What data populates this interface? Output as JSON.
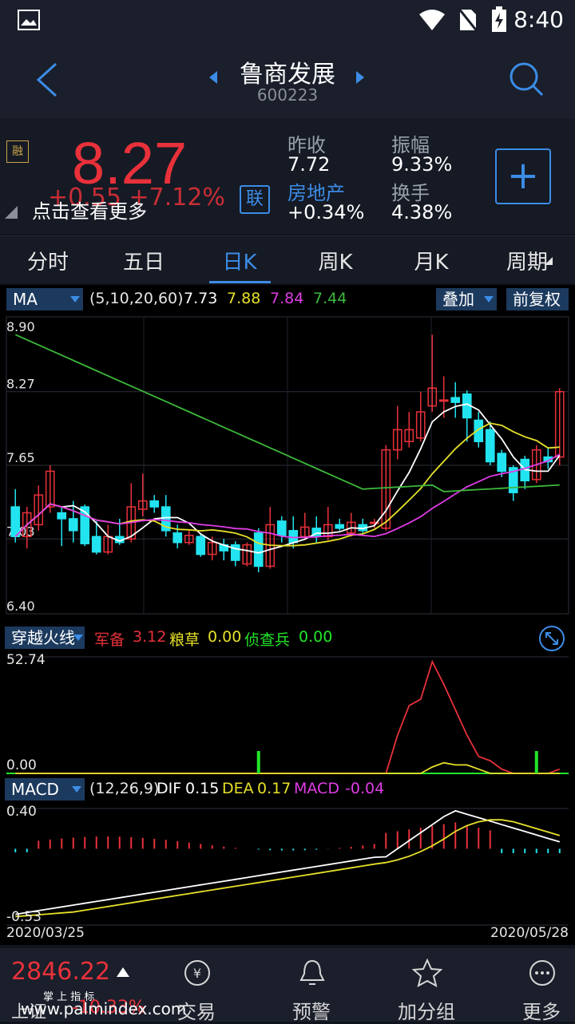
{
  "status": {
    "time": "8:40"
  },
  "header": {
    "title": "鲁商发展",
    "code": "600223"
  },
  "quote": {
    "price": "8.27",
    "change": "+0.55 +7.12%",
    "tip": "点击查看更多",
    "badge_rong": "融",
    "badge_lian": "联",
    "prev_close_label": "昨收",
    "prev_close": "7.72",
    "amplitude_label": "振幅",
    "amplitude": "9.33%",
    "sector_label": "房地产",
    "sector_change": "+0.34%",
    "turnover_label": "换手",
    "turnover": "4.38%"
  },
  "tabs": [
    "分时",
    "五日",
    "日K",
    "周K",
    "月K",
    "周期"
  ],
  "ma_bar": {
    "selector": "MA",
    "params": "(5,10,20,60)",
    "v1": "7.73",
    "v2": "7.88",
    "v3": "7.84",
    "v4": "7.44",
    "overlay": "叠加",
    "adjust": "前复权"
  },
  "colors": {
    "up": "#e8313a",
    "down": "#22e4f0",
    "ma5": "#ffffff",
    "ma10": "#e6e02a",
    "ma20": "#e03ce6",
    "ma60": "#3cb83c",
    "accent": "#3c8ce6"
  },
  "price_axis": {
    "labels": [
      "8.90",
      "8.27",
      "7.65",
      "7.03",
      "6.40"
    ]
  },
  "ind1": {
    "selector": "穿越火线",
    "a_label": "军备",
    "a_val": "3.12",
    "b_label": "粮草",
    "b_val": "0.00",
    "c_label": "侦查兵",
    "c_val": "0.00",
    "max": "52.74",
    "min": "0.00"
  },
  "macd": {
    "selector": "MACD",
    "params": "(12,26,9)",
    "dif_label": "DIF",
    "dif": "0.15",
    "dea_label": "DEA",
    "dea": "0.17",
    "macd_label": "MACD",
    "macd": "-0.04",
    "max": "0.40",
    "min": "-0.53"
  },
  "dates": {
    "start": "2020/03/25",
    "end": "2020/05/28"
  },
  "bottom": {
    "index_value": "2846.22",
    "index_name": "上证",
    "index_change": "-10.33%",
    "watermark": "www.palmindex.com",
    "watermark_brand": "掌 上 指 标",
    "items": [
      "交易",
      "预警",
      "加分组",
      "更多"
    ]
  },
  "chart_data": {
    "type": "candlestick",
    "y_range": [
      6.4,
      8.9
    ],
    "candles": [
      [
        7.3,
        7.05,
        7.45,
        7.0
      ],
      [
        7.05,
        7.25,
        7.3,
        6.95
      ],
      [
        7.15,
        7.4,
        7.48,
        7.1
      ],
      [
        7.3,
        7.6,
        7.65,
        7.25
      ],
      [
        7.25,
        7.2,
        7.3,
        6.97
      ],
      [
        7.2,
        7.1,
        7.35,
        7.0
      ],
      [
        7.3,
        6.99,
        7.32,
        6.97
      ],
      [
        7.05,
        6.92,
        7.18,
        6.9
      ],
      [
        6.92,
        7.05,
        7.15,
        6.9
      ],
      [
        7.05,
        7.0,
        7.2,
        6.98
      ],
      [
        7.03,
        7.3,
        7.5,
        7.0
      ],
      [
        7.28,
        7.35,
        7.58,
        7.22
      ],
      [
        7.35,
        7.3,
        7.4,
        7.25
      ],
      [
        7.3,
        7.1,
        7.4,
        7.05
      ],
      [
        7.08,
        7.0,
        7.15,
        6.95
      ],
      [
        7.0,
        7.06,
        7.1,
        6.98
      ],
      [
        7.05,
        6.9,
        7.08,
        6.88
      ],
      [
        6.9,
        7.0,
        7.05,
        6.85
      ],
      [
        6.98,
        6.93,
        7.03,
        6.85
      ],
      [
        6.98,
        6.85,
        7.01,
        6.8
      ],
      [
        6.82,
        6.98,
        7.0,
        6.8
      ],
      [
        7.08,
        6.8,
        7.12,
        6.75
      ],
      [
        6.8,
        7.15,
        7.3,
        6.78
      ],
      [
        7.18,
        7.06,
        7.22,
        7.0
      ],
      [
        7.1,
        7.0,
        7.22,
        6.95
      ],
      [
        7.05,
        7.13,
        7.25,
        7.02
      ],
      [
        7.12,
        7.05,
        7.22,
        7.0
      ],
      [
        7.05,
        7.15,
        7.3,
        7.02
      ],
      [
        7.15,
        7.12,
        7.2,
        7.1
      ],
      [
        7.08,
        7.17,
        7.25,
        7.05
      ],
      [
        7.15,
        7.1,
        7.2,
        7.08
      ],
      [
        7.17,
        7.17,
        7.2,
        7.12
      ],
      [
        7.12,
        7.78,
        7.82,
        7.1
      ],
      [
        7.78,
        7.95,
        8.15,
        7.7
      ],
      [
        7.85,
        7.95,
        8.1,
        7.8
      ],
      [
        7.88,
        8.1,
        8.27,
        7.85
      ],
      [
        8.15,
        8.3,
        8.75,
        8.1
      ],
      [
        8.2,
        8.2,
        8.4,
        8.05
      ],
      [
        8.22,
        8.18,
        8.35,
        8.05
      ],
      [
        8.25,
        8.05,
        8.28,
        7.85
      ],
      [
        8.03,
        7.85,
        8.1,
        7.8
      ],
      [
        7.95,
        7.68,
        8.02,
        7.65
      ],
      [
        7.75,
        7.6,
        7.78,
        7.55
      ],
      [
        7.63,
        7.42,
        7.65,
        7.35
      ],
      [
        7.7,
        7.52,
        7.73,
        7.45
      ],
      [
        7.53,
        7.78,
        7.82,
        7.5
      ],
      [
        7.72,
        7.68,
        7.8,
        7.62
      ],
      [
        7.72,
        8.27,
        8.3,
        7.65
      ]
    ]
  }
}
